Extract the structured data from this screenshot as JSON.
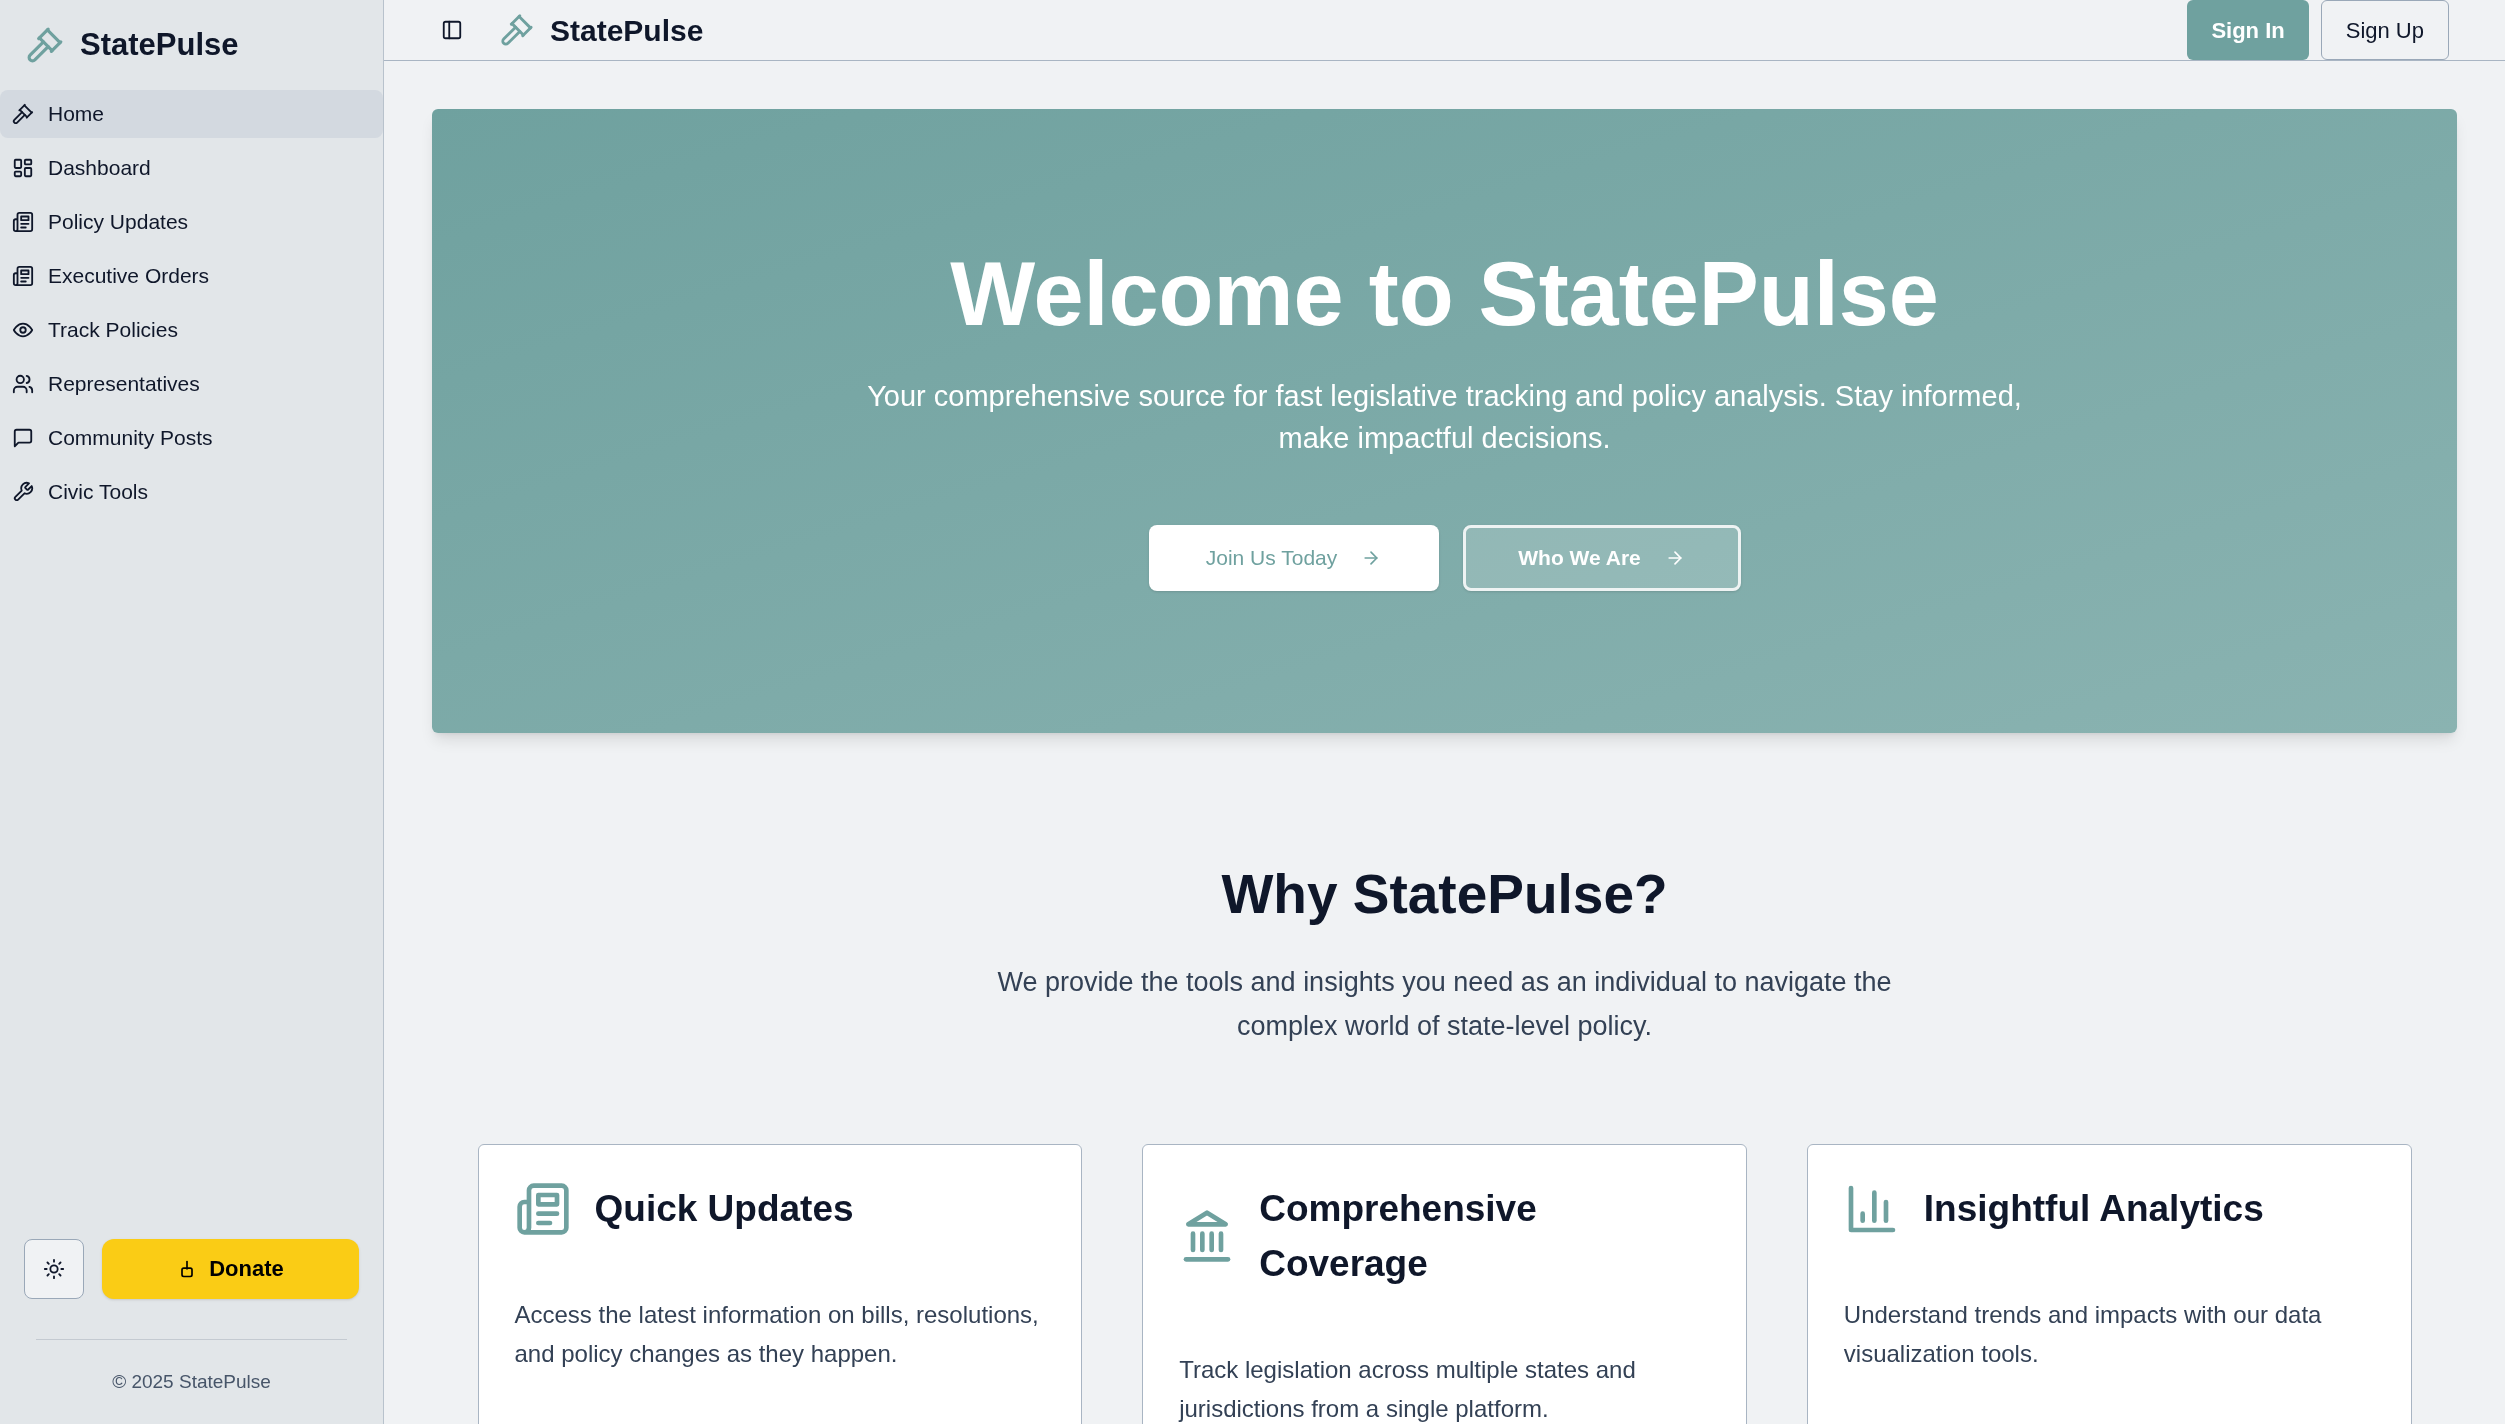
{
  "sidebar": {
    "brand": "StatePulse",
    "items": [
      {
        "label": "Home",
        "selected": true
      },
      {
        "label": "Dashboard",
        "selected": false
      },
      {
        "label": "Policy Updates",
        "selected": false
      },
      {
        "label": "Executive Orders",
        "selected": false
      },
      {
        "label": "Track Policies",
        "selected": false
      },
      {
        "label": "Representatives",
        "selected": false
      },
      {
        "label": "Community Posts",
        "selected": false
      },
      {
        "label": "Civic Tools",
        "selected": false
      }
    ],
    "donate_button": "Donate",
    "copyright": "© 2025 StatePulse"
  },
  "header": {
    "brand": "StatePulse",
    "buttons": [
      "Sign In",
      "Sign Up"
    ]
  },
  "hero": {
    "title": "Welcome to StatePulse",
    "subtitle": "Your comprehensive source for fast legislative tracking and policy analysis. Stay informed, make impactful decisions.",
    "buttons": [
      "Join Us Today",
      "Who We Are"
    ]
  },
  "why": {
    "title": "Why StatePulse?",
    "text": "We provide the tools and insights you need as an individual to navigate the complex world of state-level policy.",
    "cards": [
      {
        "title": "Quick Updates",
        "text": "Access the latest information on bills, resolutions, and policy changes as they happen."
      },
      {
        "title": "Comprehensive Coverage",
        "text": "Track legislation across multiple states and jurisdictions from a single platform."
      },
      {
        "title": "Insightful Analytics",
        "text": "Understand trends and impacts with our data visualization tools."
      }
    ]
  }
}
